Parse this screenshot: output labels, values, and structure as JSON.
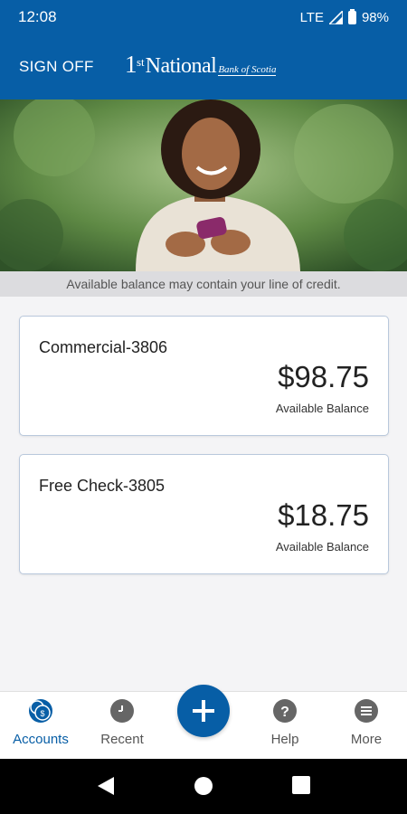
{
  "status_bar": {
    "time": "12:08",
    "network": "LTE",
    "battery": "98%"
  },
  "app_bar": {
    "sign_off_label": "SIGN OFF",
    "logo": {
      "ordinal": "1",
      "ordinal_suffix": "st",
      "name": "National",
      "suffix": "Bank of Scotia"
    }
  },
  "notice": "Available balance may contain your line of credit.",
  "accounts": [
    {
      "name": "Commercial-3806",
      "amount": "$98.75",
      "amount_label": "Available Balance"
    },
    {
      "name": "Free Check-3805",
      "amount": "$18.75",
      "amount_label": "Available Balance"
    }
  ],
  "tab_bar": {
    "accounts_label": "Accounts",
    "accounts_icon": "dollar-coins-icon",
    "recent_label": "Recent",
    "recent_icon": "clock-icon",
    "add_icon": "plus-icon",
    "help_label": "Help",
    "help_icon": "question-icon",
    "more_label": "More",
    "more_icon": "menu-icon"
  },
  "colors": {
    "brand_blue": "#075ea6",
    "card_border": "#b9c8dc",
    "notice_bg": "#dcdcdf"
  }
}
